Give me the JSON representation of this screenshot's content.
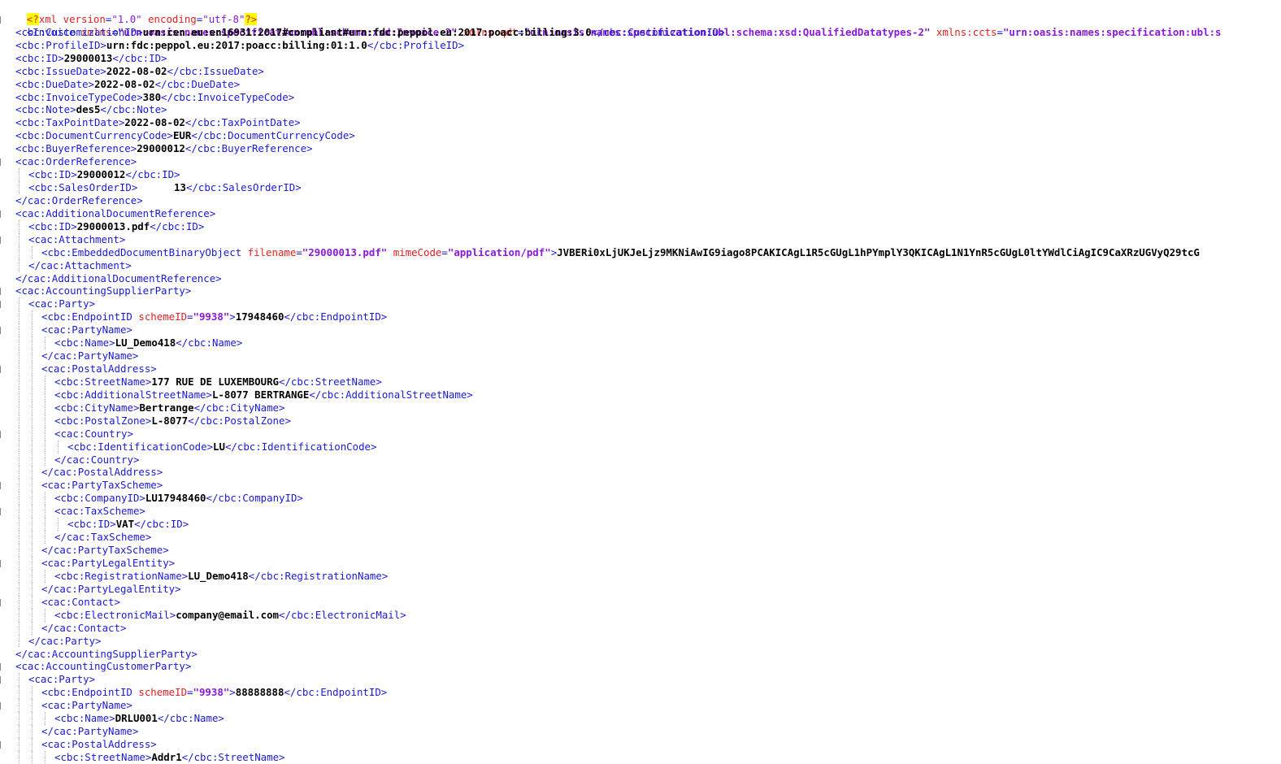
{
  "decl": {
    "open": "<?",
    "name": "xml",
    "version_attr": "version",
    "version_val": "\"1.0\"",
    "encoding_attr": "encoding",
    "encoding_val": "\"utf-8\"",
    "close": "?>"
  },
  "root": {
    "tag": "<Invoice",
    "attr1": "xmlns",
    "val1": "\"urn:oasis:names:specification:ubl:schema:xsd:Invoice-2\"",
    "attr2": "xmlns:qdt",
    "val2": "\"urn:oasis:names:specification:ubl:schema:xsd:QualifiedDatatypes-2\"",
    "attr3": "xmlns:ccts",
    "val3": "\"urn:oasis:names:specification:ubl:s"
  },
  "lines": [
    {
      "indent": 1,
      "parts": [
        [
          "t",
          "<cbc:CustomizationID>"
        ],
        [
          "v",
          "urn:cen.eu:en16931:2017#compliant#urn:fdc:peppol.eu:2017:poacc:billing:3.0"
        ],
        [
          "t",
          "</cbc:CustomizationID>"
        ]
      ]
    },
    {
      "indent": 1,
      "parts": [
        [
          "t",
          "<cbc:ProfileID>"
        ],
        [
          "v",
          "urn:fdc:peppol.eu:2017:poacc:billing:01:1.0"
        ],
        [
          "t",
          "</cbc:ProfileID>"
        ]
      ]
    },
    {
      "indent": 1,
      "parts": [
        [
          "t",
          "<cbc:ID>"
        ],
        [
          "v",
          "29000013"
        ],
        [
          "t",
          "</cbc:ID>"
        ]
      ]
    },
    {
      "indent": 1,
      "parts": [
        [
          "t",
          "<cbc:IssueDate>"
        ],
        [
          "v",
          "2022-08-02"
        ],
        [
          "t",
          "</cbc:IssueDate>"
        ]
      ]
    },
    {
      "indent": 1,
      "parts": [
        [
          "t",
          "<cbc:DueDate>"
        ],
        [
          "v",
          "2022-08-02"
        ],
        [
          "t",
          "</cbc:DueDate>"
        ]
      ]
    },
    {
      "indent": 1,
      "parts": [
        [
          "t",
          "<cbc:InvoiceTypeCode>"
        ],
        [
          "v",
          "380"
        ],
        [
          "t",
          "</cbc:InvoiceTypeCode>"
        ]
      ]
    },
    {
      "indent": 1,
      "parts": [
        [
          "t",
          "<cbc:Note>"
        ],
        [
          "v",
          "des5"
        ],
        [
          "t",
          "</cbc:Note>"
        ]
      ]
    },
    {
      "indent": 1,
      "parts": [
        [
          "t",
          "<cbc:TaxPointDate>"
        ],
        [
          "v",
          "2022-08-02"
        ],
        [
          "t",
          "</cbc:TaxPointDate>"
        ]
      ]
    },
    {
      "indent": 1,
      "parts": [
        [
          "t",
          "<cbc:DocumentCurrencyCode>"
        ],
        [
          "v",
          "EUR"
        ],
        [
          "t",
          "</cbc:DocumentCurrencyCode>"
        ]
      ]
    },
    {
      "indent": 1,
      "parts": [
        [
          "t",
          "<cbc:BuyerReference>"
        ],
        [
          "v",
          "29000012"
        ],
        [
          "t",
          "</cbc:BuyerReference>"
        ]
      ]
    },
    {
      "indent": 1,
      "fold": true,
      "parts": [
        [
          "t",
          "<cac:OrderReference>"
        ]
      ]
    },
    {
      "indent": 2,
      "parts": [
        [
          "t",
          "<cbc:ID>"
        ],
        [
          "v",
          "29000012"
        ],
        [
          "t",
          "</cbc:ID>"
        ]
      ]
    },
    {
      "indent": 2,
      "parts": [
        [
          "t",
          "<cbc:SalesOrderID>"
        ],
        [
          "v",
          "      13"
        ],
        [
          "t",
          "</cbc:SalesOrderID>"
        ]
      ]
    },
    {
      "indent": 1,
      "parts": [
        [
          "t",
          "</cac:OrderReference>"
        ]
      ]
    },
    {
      "indent": 1,
      "fold": true,
      "parts": [
        [
          "t",
          "<cac:AdditionalDocumentReference>"
        ]
      ]
    },
    {
      "indent": 2,
      "parts": [
        [
          "t",
          "<cbc:ID>"
        ],
        [
          "v",
          "29000013.pdf"
        ],
        [
          "t",
          "</cbc:ID>"
        ]
      ]
    },
    {
      "indent": 2,
      "fold": true,
      "parts": [
        [
          "t",
          "<cac:Attachment>"
        ]
      ]
    },
    {
      "indent": 3,
      "parts": [
        [
          "t",
          "<cbc:EmbeddedDocumentBinaryObject "
        ],
        [
          "a",
          "filename"
        ],
        [
          "t",
          "="
        ],
        [
          "q",
          "\"29000013.pdf\""
        ],
        [
          "t",
          " "
        ],
        [
          "a",
          "mimeCode"
        ],
        [
          "t",
          "="
        ],
        [
          "q",
          "\"application/pdf\""
        ],
        [
          "t",
          ">"
        ],
        [
          "v",
          "JVBERi0xLjUKJeLjz9MKNiAwIG9iago8PCAKICAgL1R5cGUgL1hPYmplY3QKICAgL1N1YnR5cGUgL0ltYWdlCiAgIC9CaXRzUGVyQ29tcG"
        ]
      ]
    },
    {
      "indent": 2,
      "parts": [
        [
          "t",
          "</cac:Attachment>"
        ]
      ]
    },
    {
      "indent": 1,
      "parts": [
        [
          "t",
          "</cac:AdditionalDocumentReference>"
        ]
      ]
    },
    {
      "indent": 1,
      "fold": true,
      "parts": [
        [
          "t",
          "<cac:AccountingSupplierParty>"
        ]
      ]
    },
    {
      "indent": 2,
      "fold": true,
      "parts": [
        [
          "t",
          "<cac:Party>"
        ]
      ]
    },
    {
      "indent": 3,
      "parts": [
        [
          "t",
          "<cbc:EndpointID "
        ],
        [
          "a",
          "schemeID"
        ],
        [
          "t",
          "="
        ],
        [
          "q",
          "\"9938\""
        ],
        [
          "t",
          ">"
        ],
        [
          "v",
          "17948460"
        ],
        [
          "t",
          "</cbc:EndpointID>"
        ]
      ]
    },
    {
      "indent": 3,
      "fold": true,
      "parts": [
        [
          "t",
          "<cac:PartyName>"
        ]
      ]
    },
    {
      "indent": 4,
      "parts": [
        [
          "t",
          "<cbc:Name>"
        ],
        [
          "v",
          "LU_Demo418"
        ],
        [
          "t",
          "</cbc:Name>"
        ]
      ]
    },
    {
      "indent": 3,
      "parts": [
        [
          "t",
          "</cac:PartyName>"
        ]
      ]
    },
    {
      "indent": 3,
      "fold": true,
      "parts": [
        [
          "t",
          "<cac:PostalAddress>"
        ]
      ]
    },
    {
      "indent": 4,
      "parts": [
        [
          "t",
          "<cbc:StreetName>"
        ],
        [
          "v",
          "177 RUE DE LUXEMBOURG"
        ],
        [
          "t",
          "</cbc:StreetName>"
        ]
      ]
    },
    {
      "indent": 4,
      "parts": [
        [
          "t",
          "<cbc:AdditionalStreetName>"
        ],
        [
          "v",
          "L-8077 BERTRANGE"
        ],
        [
          "t",
          "</cbc:AdditionalStreetName>"
        ]
      ]
    },
    {
      "indent": 4,
      "parts": [
        [
          "t",
          "<cbc:CityName>"
        ],
        [
          "v",
          "Bertrange"
        ],
        [
          "t",
          "</cbc:CityName>"
        ]
      ]
    },
    {
      "indent": 4,
      "parts": [
        [
          "t",
          "<cbc:PostalZone>"
        ],
        [
          "v",
          "L-8077"
        ],
        [
          "t",
          "</cbc:PostalZone>"
        ]
      ]
    },
    {
      "indent": 4,
      "fold": true,
      "parts": [
        [
          "t",
          "<cac:Country>"
        ]
      ]
    },
    {
      "indent": 5,
      "parts": [
        [
          "t",
          "<cbc:IdentificationCode>"
        ],
        [
          "v",
          "LU"
        ],
        [
          "t",
          "</cbc:IdentificationCode>"
        ]
      ]
    },
    {
      "indent": 4,
      "parts": [
        [
          "t",
          "</cac:Country>"
        ]
      ]
    },
    {
      "indent": 3,
      "parts": [
        [
          "t",
          "</cac:PostalAddress>"
        ]
      ]
    },
    {
      "indent": 3,
      "fold": true,
      "parts": [
        [
          "t",
          "<cac:PartyTaxScheme>"
        ]
      ]
    },
    {
      "indent": 4,
      "parts": [
        [
          "t",
          "<cbc:CompanyID>"
        ],
        [
          "v",
          "LU17948460"
        ],
        [
          "t",
          "</cbc:CompanyID>"
        ]
      ]
    },
    {
      "indent": 4,
      "fold": true,
      "parts": [
        [
          "t",
          "<cac:TaxScheme>"
        ]
      ]
    },
    {
      "indent": 5,
      "parts": [
        [
          "t",
          "<cbc:ID>"
        ],
        [
          "v",
          "VAT"
        ],
        [
          "t",
          "</cbc:ID>"
        ]
      ]
    },
    {
      "indent": 4,
      "parts": [
        [
          "t",
          "</cac:TaxScheme>"
        ]
      ]
    },
    {
      "indent": 3,
      "parts": [
        [
          "t",
          "</cac:PartyTaxScheme>"
        ]
      ]
    },
    {
      "indent": 3,
      "fold": true,
      "parts": [
        [
          "t",
          "<cac:PartyLegalEntity>"
        ]
      ]
    },
    {
      "indent": 4,
      "parts": [
        [
          "t",
          "<cbc:RegistrationName>"
        ],
        [
          "v",
          "LU_Demo418"
        ],
        [
          "t",
          "</cbc:RegistrationName>"
        ]
      ]
    },
    {
      "indent": 3,
      "parts": [
        [
          "t",
          "</cac:PartyLegalEntity>"
        ]
      ]
    },
    {
      "indent": 3,
      "fold": true,
      "parts": [
        [
          "t",
          "<cac:Contact>"
        ]
      ]
    },
    {
      "indent": 4,
      "parts": [
        [
          "t",
          "<cbc:ElectronicMail>"
        ],
        [
          "v",
          "company@email.com"
        ],
        [
          "t",
          "</cbc:ElectronicMail>"
        ]
      ]
    },
    {
      "indent": 3,
      "parts": [
        [
          "t",
          "</cac:Contact>"
        ]
      ]
    },
    {
      "indent": 2,
      "parts": [
        [
          "t",
          "</cac:Party>"
        ]
      ]
    },
    {
      "indent": 1,
      "parts": [
        [
          "t",
          "</cac:AccountingSupplierParty>"
        ]
      ]
    },
    {
      "indent": 1,
      "fold": true,
      "parts": [
        [
          "t",
          "<cac:AccountingCustomerParty>"
        ]
      ]
    },
    {
      "indent": 2,
      "fold": true,
      "parts": [
        [
          "t",
          "<cac:Party>"
        ]
      ]
    },
    {
      "indent": 3,
      "parts": [
        [
          "t",
          "<cbc:EndpointID "
        ],
        [
          "a",
          "schemeID"
        ],
        [
          "t",
          "="
        ],
        [
          "q",
          "\"9938\""
        ],
        [
          "t",
          ">"
        ],
        [
          "v",
          "88888888"
        ],
        [
          "t",
          "</cbc:EndpointID>"
        ]
      ]
    },
    {
      "indent": 3,
      "fold": true,
      "parts": [
        [
          "t",
          "<cac:PartyName>"
        ]
      ]
    },
    {
      "indent": 4,
      "parts": [
        [
          "t",
          "<cbc:Name>"
        ],
        [
          "v",
          "DRLU001"
        ],
        [
          "t",
          "</cbc:Name>"
        ]
      ]
    },
    {
      "indent": 3,
      "parts": [
        [
          "t",
          "</cac:PartyName>"
        ]
      ]
    },
    {
      "indent": 3,
      "fold": true,
      "parts": [
        [
          "t",
          "<cac:PostalAddress>"
        ]
      ]
    },
    {
      "indent": 4,
      "parts": [
        [
          "t",
          "<cbc:StreetName>"
        ],
        [
          "v",
          "Addr1"
        ],
        [
          "t",
          "</cbc:StreetName>"
        ]
      ]
    }
  ]
}
